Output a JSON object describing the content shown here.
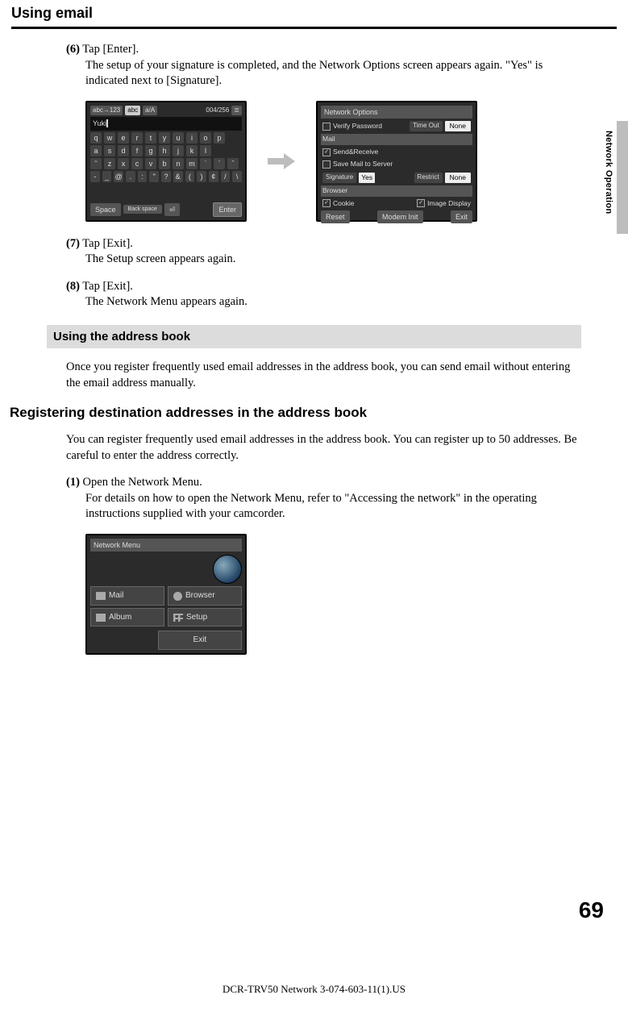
{
  "header": {
    "title": "Using email"
  },
  "side": {
    "label": "Network Operation"
  },
  "steps_a": [
    {
      "num": "(6)",
      "lead": "Tap [Enter].",
      "body": "The setup of your signature is completed, and the Network Options screen appears again. \"Yes\" is indicated next to [Signature]."
    },
    {
      "num": "(7)",
      "lead": "Tap [Exit].",
      "body": "The Setup screen appears again."
    },
    {
      "num": "(8)",
      "lead": "Tap [Exit].",
      "body": "The Network Menu appears again."
    }
  ],
  "section_bar": "Using the address book",
  "section_intro": "Once you register frequently used email addresses in the address book, you can send email without entering the email address manually.",
  "sub_heading": "Registering destination addresses in the address book",
  "sub_intro": "You can register frequently used email addresses in the address book. You can register up to 50 addresses. Be careful to enter the address correctly.",
  "steps_b": [
    {
      "num": "(1)",
      "lead": "Open the Network Menu.",
      "body": "For details on how to open the Network Menu, refer to \"Accessing the network\" in the operating instructions supplied with your camcorder."
    }
  ],
  "fig1": {
    "tabs": [
      "abc→123",
      "abc",
      "a/A"
    ],
    "counter": "004/256",
    "input_text": "Yuki",
    "row1": [
      "q",
      "w",
      "e",
      "r",
      "t",
      "y",
      "u",
      "i",
      "o",
      "p"
    ],
    "row2": [
      "a",
      "s",
      "d",
      "f",
      "g",
      "h",
      "j",
      "k",
      "l"
    ],
    "row3": [
      "˜",
      "z",
      "x",
      "c",
      "v",
      "b",
      "n",
      "m",
      "ˋ",
      "ˊ",
      "ˆ"
    ],
    "row4": [
      "-",
      "_",
      "@",
      ".",
      ":",
      "\"",
      "?",
      "&",
      "(",
      ")",
      "¢",
      "/",
      "\\"
    ],
    "bottom": {
      "space": "Space",
      "back": "Back space",
      "return": "⏎",
      "enter": "Enter"
    }
  },
  "fig2": {
    "title": "Network Options",
    "rows": [
      {
        "cb": false,
        "label": "Verify Password",
        "btn": "Time Out",
        "val": "None"
      }
    ],
    "mail_header": "Mail",
    "mail_rows": [
      {
        "cb": true,
        "label": "Send&Receive"
      },
      {
        "cb": false,
        "label": "Save Mail to Server"
      }
    ],
    "sig_row": {
      "label": "Signature",
      "yes": "Yes",
      "restrict": "Restrict",
      "val": "None"
    },
    "browser_header": "Browser",
    "browser_row": {
      "cookie_cb": true,
      "cookie": "Cookie",
      "img_cb": true,
      "img": "Image Display"
    },
    "bottom": {
      "reset": "Reset",
      "modem": "Modem Init",
      "exit": "Exit"
    }
  },
  "network_menu": {
    "title": "Network Menu",
    "buttons": {
      "mail": "Mail",
      "browser": "Browser",
      "album": "Album",
      "setup": "Setup",
      "exit": "Exit"
    }
  },
  "page_number": "69",
  "footer": "DCR-TRV50 Network 3-074-603-11(1).US"
}
